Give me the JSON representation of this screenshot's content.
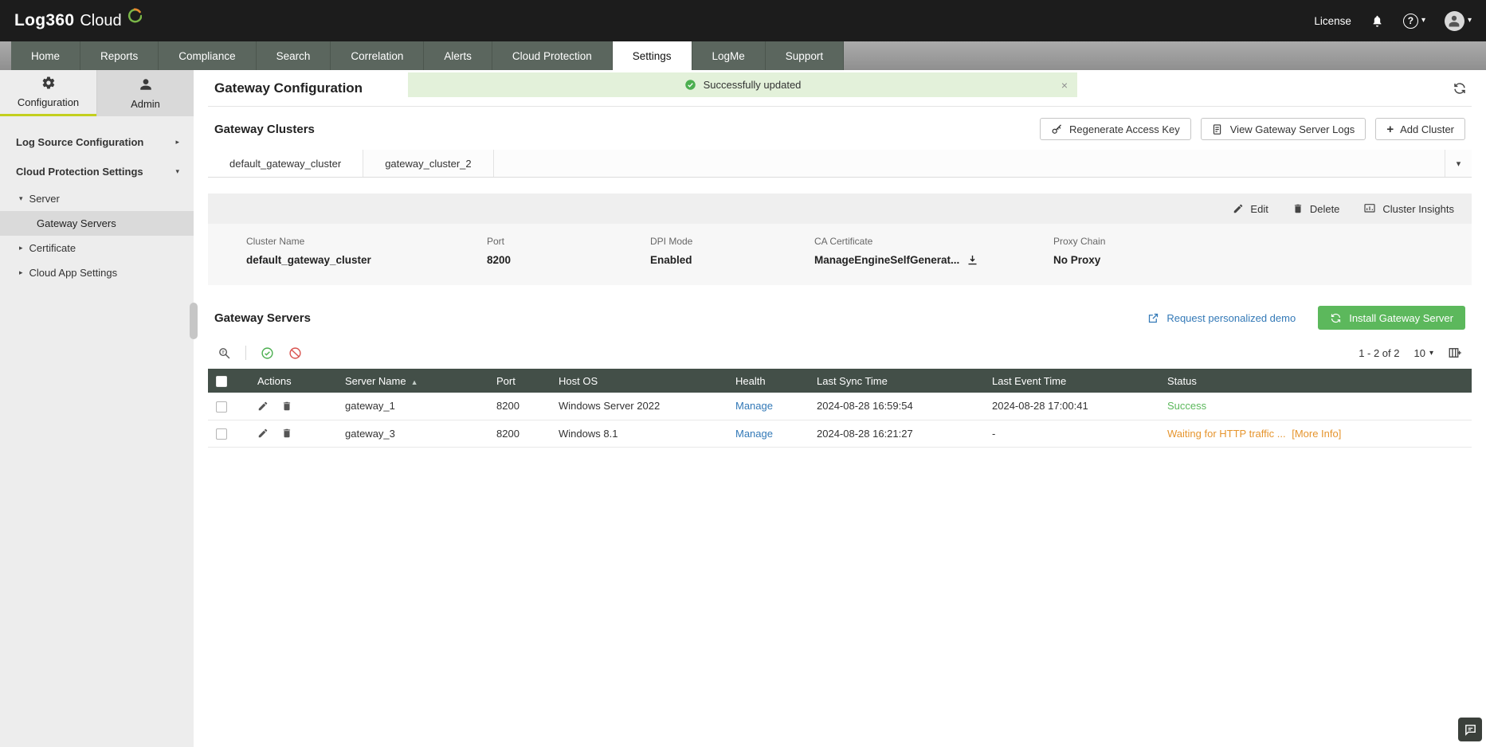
{
  "colors": {
    "success_green": "#5cb85c",
    "warning_orange": "#e6952e",
    "link_blue": "#3379b7",
    "table_header_dark": "#434f48",
    "install_button_green": "#5cb85c",
    "toast_green_bg": "#e3f1da"
  },
  "icons": {
    "caret_down": "▾",
    "arrow_right": "▸",
    "arrow_down": "▾",
    "sort_asc": "▲",
    "close": "×",
    "plus": "+",
    "question": "?"
  },
  "topbar": {
    "logo_primary": "Log360",
    "logo_secondary": "Cloud",
    "license_label": "License"
  },
  "nav": {
    "items": [
      "Home",
      "Reports",
      "Compliance",
      "Search",
      "Correlation",
      "Alerts",
      "Cloud Protection",
      "Settings",
      "LogMe",
      "Support"
    ],
    "active": "Settings"
  },
  "sidebar": {
    "tab_configuration": "Configuration",
    "tab_admin": "Admin",
    "log_source": "Log Source Configuration",
    "cloud_protection": "Cloud Protection Settings",
    "server": "Server",
    "gateway_servers": "Gateway Servers",
    "certificate": "Certificate",
    "cloud_app_settings": "Cloud App Settings"
  },
  "page": {
    "title": "Gateway Configuration",
    "toast_message": "Successfully updated"
  },
  "clusters": {
    "heading": "Gateway Clusters",
    "regenerate_button": "Regenerate Access Key",
    "view_logs_button": "View Gateway Server Logs",
    "add_cluster_button": "Add Cluster",
    "tabs": [
      "default_gateway_cluster",
      "gateway_cluster_2"
    ],
    "edit_label": "Edit",
    "delete_label": "Delete",
    "insights_label": "Cluster Insights",
    "fields": [
      {
        "label": "Cluster Name",
        "value": "default_gateway_cluster"
      },
      {
        "label": "Port",
        "value": "8200"
      },
      {
        "label": "DPI Mode",
        "value": "Enabled"
      },
      {
        "label": "CA Certificate",
        "value": "ManageEngineSelfGenerat..."
      },
      {
        "label": "Proxy Chain",
        "value": "No Proxy"
      }
    ]
  },
  "servers": {
    "heading": "Gateway Servers",
    "demo_link": "Request personalized demo",
    "install_button": "Install Gateway Server",
    "pagination": "1 - 2 of 2",
    "page_size": "10",
    "columns": [
      "Actions",
      "Server Name",
      "Port",
      "Host OS",
      "Health",
      "Last Sync Time",
      "Last Event Time",
      "Status"
    ],
    "rows": [
      {
        "name": "gateway_1",
        "port": "8200",
        "os": "Windows Server 2022",
        "health": "Manage",
        "last_sync": "2024-08-28 16:59:54",
        "last_event": "2024-08-28 17:00:41",
        "status": "Success",
        "status_type": "success"
      },
      {
        "name": "gateway_3",
        "port": "8200",
        "os": "Windows 8.1",
        "health": "Manage",
        "last_sync": "2024-08-28 16:21:27",
        "last_event": "-",
        "status": "Waiting for HTTP traffic ...",
        "status_link": "[More Info]",
        "status_type": "warning"
      }
    ]
  }
}
